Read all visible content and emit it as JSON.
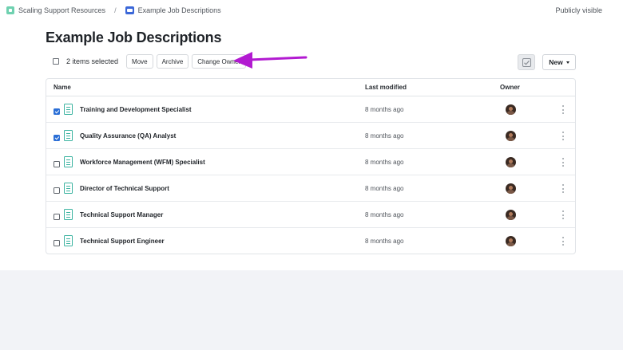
{
  "breadcrumb": {
    "root": "Scaling Support Resources",
    "separator": "/",
    "current": "Example Job Descriptions"
  },
  "visibility": "Publicly visible",
  "page_title": "Example Job Descriptions",
  "toolbar": {
    "selection_label": "2 items selected",
    "move_label": "Move",
    "archive_label": "Archive",
    "change_owner_label": "Change Owner",
    "new_label": "New"
  },
  "table": {
    "headers": {
      "name": "Name",
      "modified": "Last modified",
      "owner": "Owner"
    },
    "rows": [
      {
        "name": "Training and Development Specialist",
        "modified": "8 months ago",
        "checked": true
      },
      {
        "name": "Quality Assurance (QA) Analyst",
        "modified": "8 months ago",
        "checked": true
      },
      {
        "name": "Workforce Management (WFM) Specialist",
        "modified": "8 months ago",
        "checked": false
      },
      {
        "name": "Director of Technical Support",
        "modified": "8 months ago",
        "checked": false
      },
      {
        "name": "Technical Support Manager",
        "modified": "8 months ago",
        "checked": false
      },
      {
        "name": "Technical Support Engineer",
        "modified": "8 months ago",
        "checked": false
      }
    ]
  },
  "icons": {
    "space": "space-icon",
    "folder": "folder-icon",
    "document": "document-icon",
    "avatar": "avatar-icon",
    "more": "more-vertical-icon",
    "annotation": "arrow-annotation"
  },
  "colors": {
    "accent_blue": "#2b6fd6",
    "doc_icon": "#3bb3a0",
    "annotation_arrow": "#b21ad1"
  }
}
